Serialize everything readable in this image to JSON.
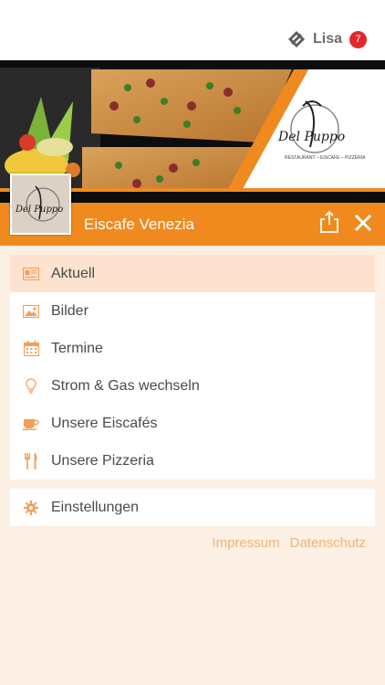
{
  "user": {
    "name": "Lisa",
    "notification_count": "7",
    "icon": "app-logo-icon"
  },
  "banner": {
    "logo_text": "Del Puppo",
    "logo_subtitle": "RESTAURANT – EISCAFE – PIZZERIA"
  },
  "header": {
    "title": "Eiscafe Venezia",
    "share_icon": "share-icon",
    "close_icon": "close-icon",
    "avatar_text": "Del Puppo"
  },
  "menu": {
    "items": [
      {
        "label": "Aktuell",
        "icon": "news-icon",
        "active": true
      },
      {
        "label": "Bilder",
        "icon": "image-icon",
        "active": false
      },
      {
        "label": "Termine",
        "icon": "calendar-icon",
        "active": false
      },
      {
        "label": "Strom & Gas wechseln",
        "icon": "lightbulb-icon",
        "active": false
      },
      {
        "label": "Unsere Eiscafés",
        "icon": "coffee-cup-icon",
        "active": false
      },
      {
        "label": "Unsere Pizzeria",
        "icon": "cutlery-icon",
        "active": false
      }
    ],
    "settings": {
      "label": "Einstellungen",
      "icon": "gear-icon"
    }
  },
  "footer": {
    "impressum": "Impressum",
    "datenschutz": "Datenschutz"
  },
  "colors": {
    "accent": "#f08a1e",
    "active_bg": "#fde3cf",
    "page_bg": "#fdf0e4",
    "badge": "#e4262b",
    "icon": "#f2a057",
    "link": "#f2b27a"
  }
}
